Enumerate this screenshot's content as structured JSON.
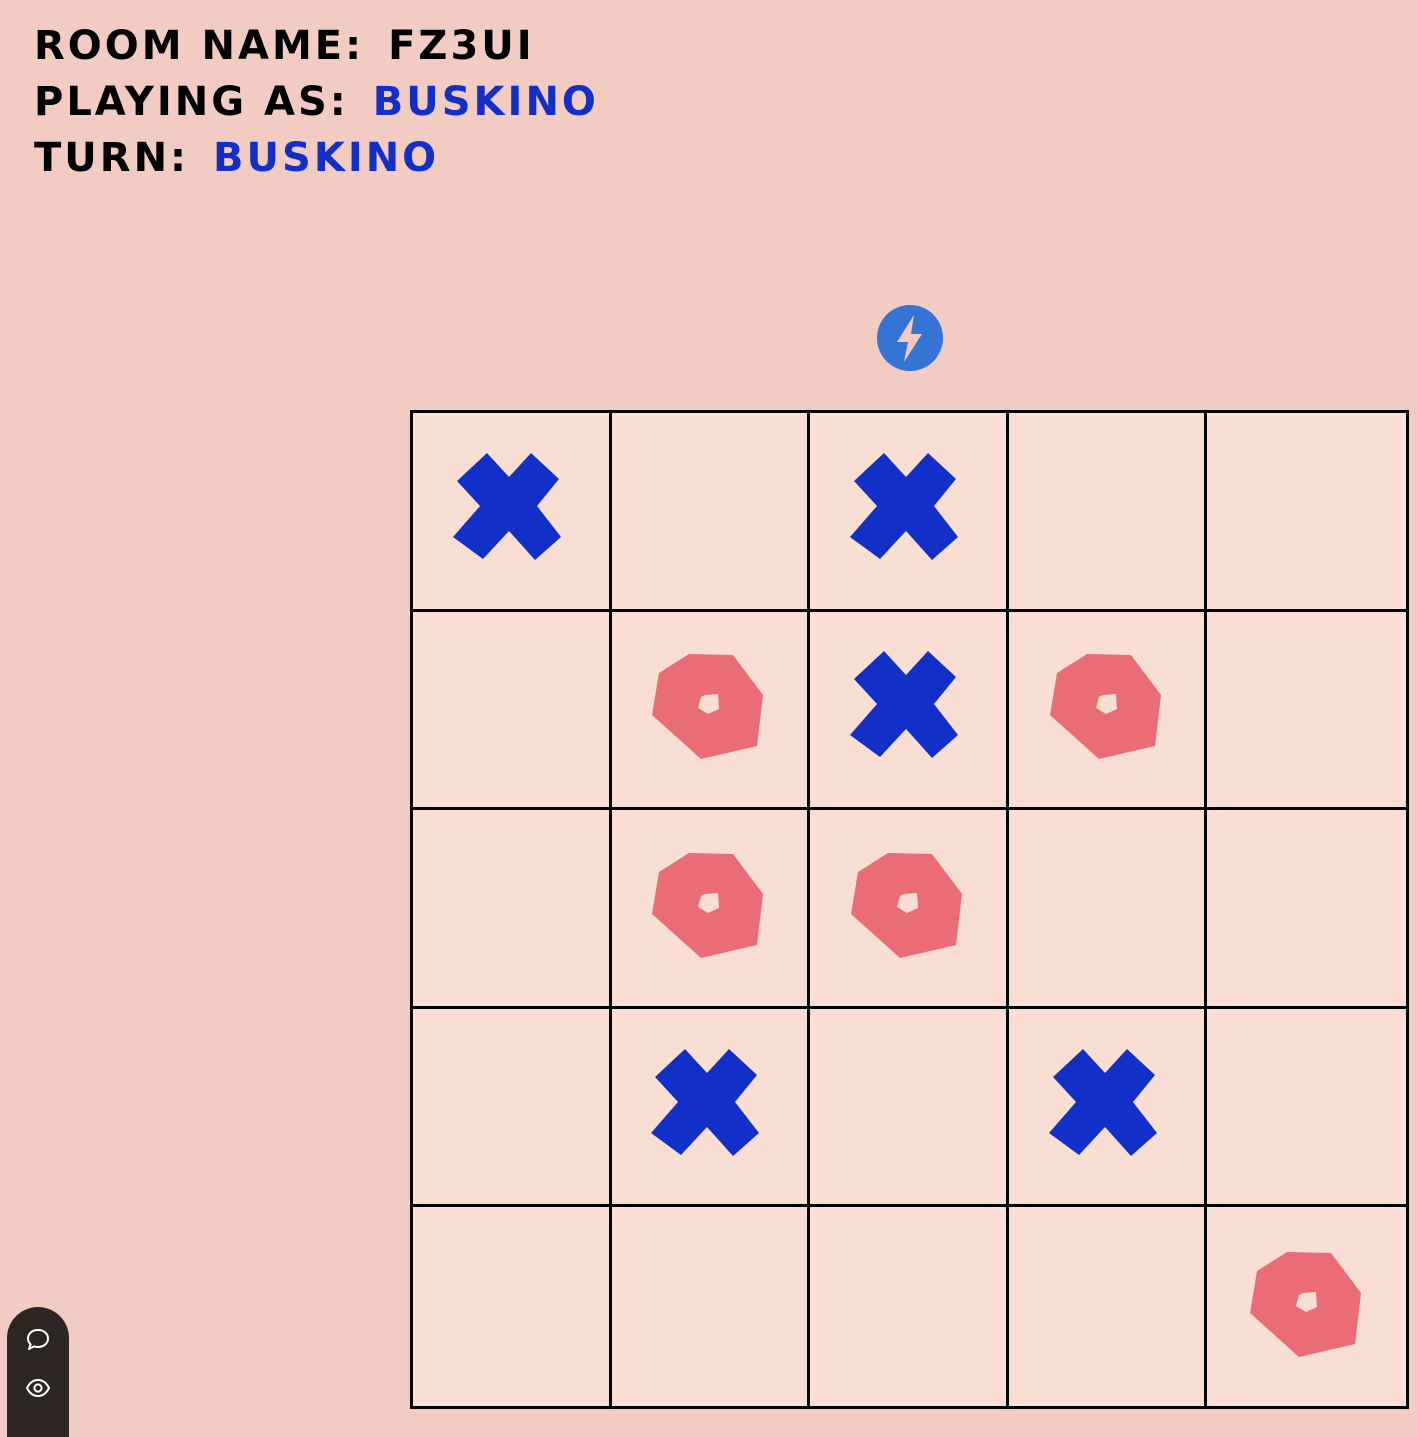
{
  "header": {
    "room_label": "Room Name:",
    "room_value": "FZ3UI",
    "playing_label": "Playing as:",
    "playing_value": "BUSKINO",
    "turn_label": "Turn:",
    "turn_value": "BUSKINO"
  },
  "colors": {
    "background": "#f2cbc3",
    "cell": "#f9ded4",
    "x_mark": "#1230c8",
    "o_mark": "#e96c77",
    "badge": "#3573d4",
    "dock": "#2d2624"
  },
  "icons": {
    "badge": "lightning-bolt-icon",
    "dock": [
      "chat-icon",
      "eye-icon"
    ]
  },
  "board": {
    "rows": 5,
    "cols": 5,
    "cells": [
      "X",
      "",
      "X",
      "",
      "",
      "",
      "O",
      "X",
      "O",
      "",
      "",
      "O",
      "O",
      "",
      "",
      "",
      "X",
      "",
      "X",
      "",
      "",
      "",
      "",
      "",
      "O"
    ]
  }
}
